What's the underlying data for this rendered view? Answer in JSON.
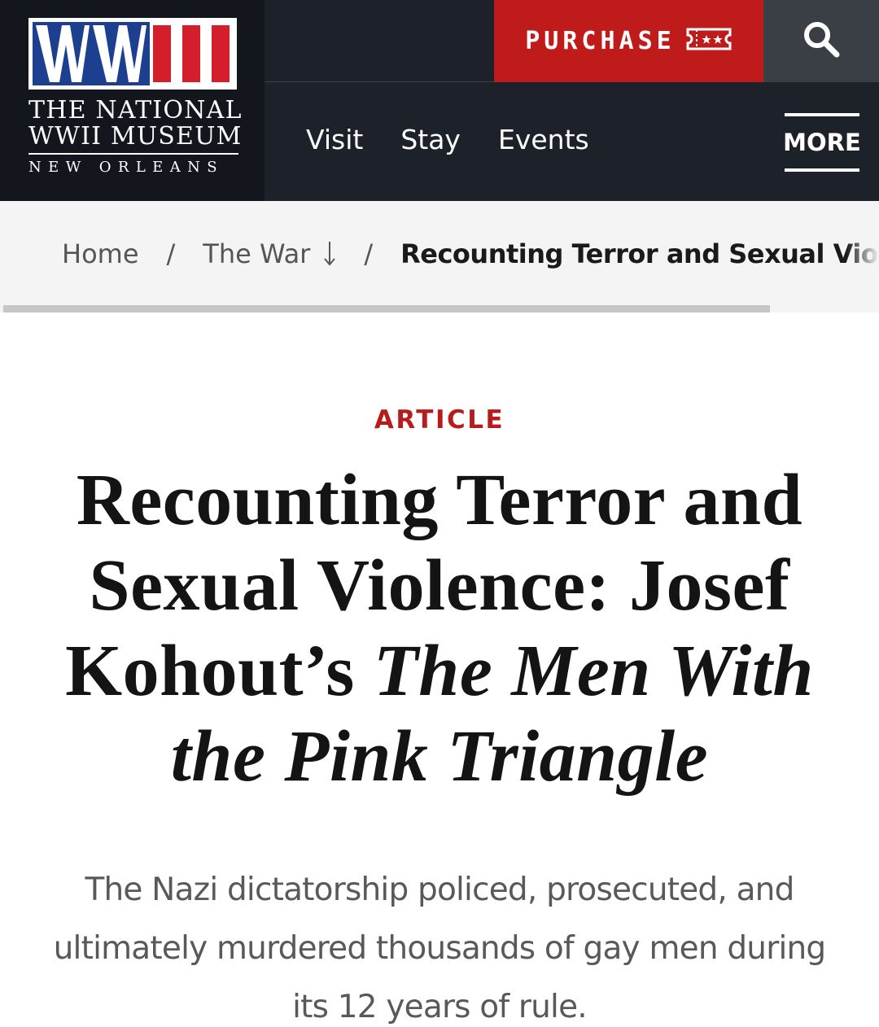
{
  "header": {
    "logo": {
      "mark": "WWII",
      "line1": "THE NATIONAL",
      "line2": "WWII MUSEUM",
      "line3": "NEW ORLEANS"
    },
    "purchase_label": "PURCHASE",
    "nav": [
      {
        "label": "Visit"
      },
      {
        "label": "Stay"
      },
      {
        "label": "Events"
      }
    ],
    "more_label": "MORE"
  },
  "breadcrumb": {
    "home": "Home",
    "section": "The War",
    "current": "Recounting Terror and Sexual Violence: Josef Kohout’s The Men With the Pink Triangle",
    "separator": "/"
  },
  "article": {
    "kicker": "ARTICLE",
    "title_plain": "Recounting Terror and Sexual Violence: Josef Kohout’s",
    "title_italic": "The Men With the Pink Triangle",
    "lede": "The Nazi dictatorship policed, prosecuted, and ultimately murdered thousands of gay men during its 12 years of rule."
  },
  "colors": {
    "header_bg": "#1d2129",
    "logo_bg": "#13161c",
    "purchase_red": "#c01b1b",
    "search_bg": "#3a3e45",
    "kicker_red": "#b71c1c",
    "logo_blue": "#1c3f8f"
  },
  "icons": {
    "purchase": "ticket-icon",
    "search": "search-icon",
    "breadcrumb_dropdown": "arrow-down-icon"
  }
}
